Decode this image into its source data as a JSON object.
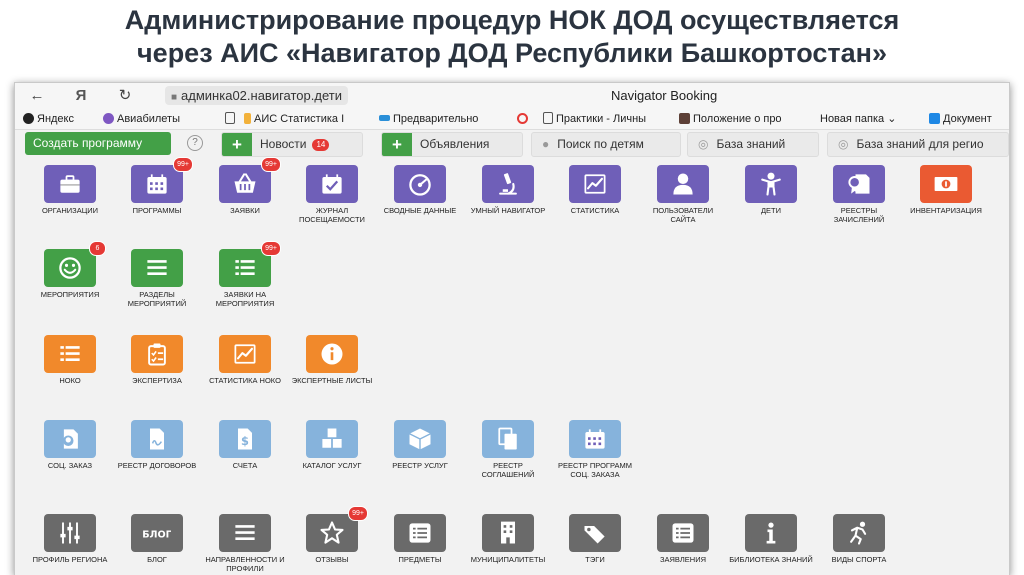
{
  "slide": {
    "title_line1": "Администрирование процедур НОК ДОД осуществляется",
    "title_line2": "через АИС «Навигатор ДОД Республики Башкортостан»"
  },
  "browser": {
    "url": "админка02.навигатор.дети",
    "page_title": "Navigator Booking",
    "bookmarks": [
      "Яндекс",
      "Авиабилеты",
      "АИС Статистика I",
      "Предварительно",
      "Практики - Личны",
      "Положение о про",
      "Новая папка",
      "Документ"
    ]
  },
  "toolbar": {
    "create_label": "Создать программу",
    "help_symbol": "?",
    "news_label": "Новости",
    "news_badge": "14",
    "announcements_label": "Объявления",
    "search_children_label": "Поиск по детям",
    "knowledge_label": "База знаний",
    "knowledge_regions_label": "База знаний для регио"
  },
  "tiles": [
    {
      "key": "org",
      "label": "Организации",
      "icon": "briefcase-icon",
      "color": "#6f5fb8"
    },
    {
      "key": "programs",
      "label": "Программы",
      "icon": "calendar-icon",
      "color": "#6f5fb8",
      "badge": "99+"
    },
    {
      "key": "requests",
      "label": "Заявки",
      "icon": "basket-icon",
      "color": "#6f5fb8",
      "badge": "99+"
    },
    {
      "key": "journal",
      "label": "Журнал посещаемости",
      "icon": "calendar-check-icon",
      "color": "#6f5fb8"
    },
    {
      "key": "summary",
      "label": "Сводные данные",
      "icon": "gauge-icon",
      "color": "#6f5fb8"
    },
    {
      "key": "smart",
      "label": "Умный навигатор",
      "icon": "microscope-icon",
      "color": "#6f5fb8"
    },
    {
      "key": "stats",
      "label": "Статистика",
      "icon": "chart-icon",
      "color": "#6f5fb8"
    },
    {
      "key": "users",
      "label": "Пользователи сайта",
      "icon": "user-icon",
      "color": "#6f5fb8"
    },
    {
      "key": "children",
      "label": "Дети",
      "icon": "child-icon",
      "color": "#6f5fb8"
    },
    {
      "key": "registries",
      "label": "Реестры зачислений",
      "icon": "certificate-icon",
      "color": "#6f5fb8"
    },
    {
      "key": "inventory",
      "label": "Инвентаризация",
      "icon": "money-icon",
      "color": "#ea5a32"
    },
    {
      "key": "events",
      "label": "Мероприятия",
      "icon": "smiley-icon",
      "color": "#43a047",
      "badge": "6"
    },
    {
      "key": "event_sections",
      "label": "Разделы мероприятий",
      "icon": "menu-icon",
      "color": "#43a047"
    },
    {
      "key": "event_requests",
      "label": "Заявки на мероприятия",
      "icon": "list-icon",
      "color": "#43a047",
      "badge": "99+"
    },
    {
      "key": "noko",
      "label": "НОКО",
      "icon": "list-icon",
      "color": "#f1892b"
    },
    {
      "key": "expertise",
      "label": "Экспертиза",
      "icon": "clipboard-icon",
      "color": "#f1892b"
    },
    {
      "key": "noko_stats",
      "label": "Статистика НОКО",
      "icon": "chart-icon",
      "color": "#f1892b"
    },
    {
      "key": "expert_sheets",
      "label": "Экспертные листы",
      "icon": "info-circle-icon",
      "color": "#f1892b"
    },
    {
      "key": "social_order",
      "label": "Соц. заказ",
      "icon": "location-doc-icon",
      "color": "#86b3dc"
    },
    {
      "key": "contracts",
      "label": "Реестр договоров",
      "icon": "doc-signature-icon",
      "color": "#86b3dc"
    },
    {
      "key": "invoices",
      "label": "Счета",
      "icon": "doc-dollar-icon",
      "color": "#86b3dc"
    },
    {
      "key": "services_catalog",
      "label": "Каталог услуг",
      "icon": "cubes-icon",
      "color": "#86b3dc"
    },
    {
      "key": "services_registry",
      "label": "Реестр услуг",
      "icon": "box-icon",
      "color": "#86b3dc"
    },
    {
      "key": "agreements",
      "label": "Реестр соглашений",
      "icon": "copy-icon",
      "color": "#86b3dc"
    },
    {
      "key": "so_programs",
      "label": "Реестр программ соц. заказа",
      "icon": "calendar-icon",
      "color": "#86b3dc"
    },
    {
      "key": "region_profile",
      "label": "Профиль региона",
      "icon": "sliders-icon",
      "color": "#6a6a6a"
    },
    {
      "key": "blog",
      "label": "Блог",
      "icon": "blog-icon",
      "color": "#6a6a6a"
    },
    {
      "key": "directions",
      "label": "Направленности и профили",
      "icon": "menu-icon",
      "color": "#6a6a6a"
    },
    {
      "key": "reviews",
      "label": "Отзывы",
      "icon": "star-icon",
      "color": "#6a6a6a",
      "badge": "99+"
    },
    {
      "key": "subjects",
      "label": "Предметы",
      "icon": "list-box-icon",
      "color": "#6a6a6a"
    },
    {
      "key": "municipalities",
      "label": "Муниципалитеты",
      "icon": "building-icon",
      "color": "#6a6a6a"
    },
    {
      "key": "tags",
      "label": "Тэги",
      "icon": "tags-icon",
      "color": "#6a6a6a"
    },
    {
      "key": "statements",
      "label": "Заявления",
      "icon": "list-box-icon",
      "color": "#6a6a6a"
    },
    {
      "key": "knowledge_lib",
      "label": "Библиотека знаний",
      "icon": "info-icon",
      "color": "#6a6a6a"
    },
    {
      "key": "sports",
      "label": "Виды спорта",
      "icon": "running-icon",
      "color": "#6a6a6a"
    }
  ]
}
